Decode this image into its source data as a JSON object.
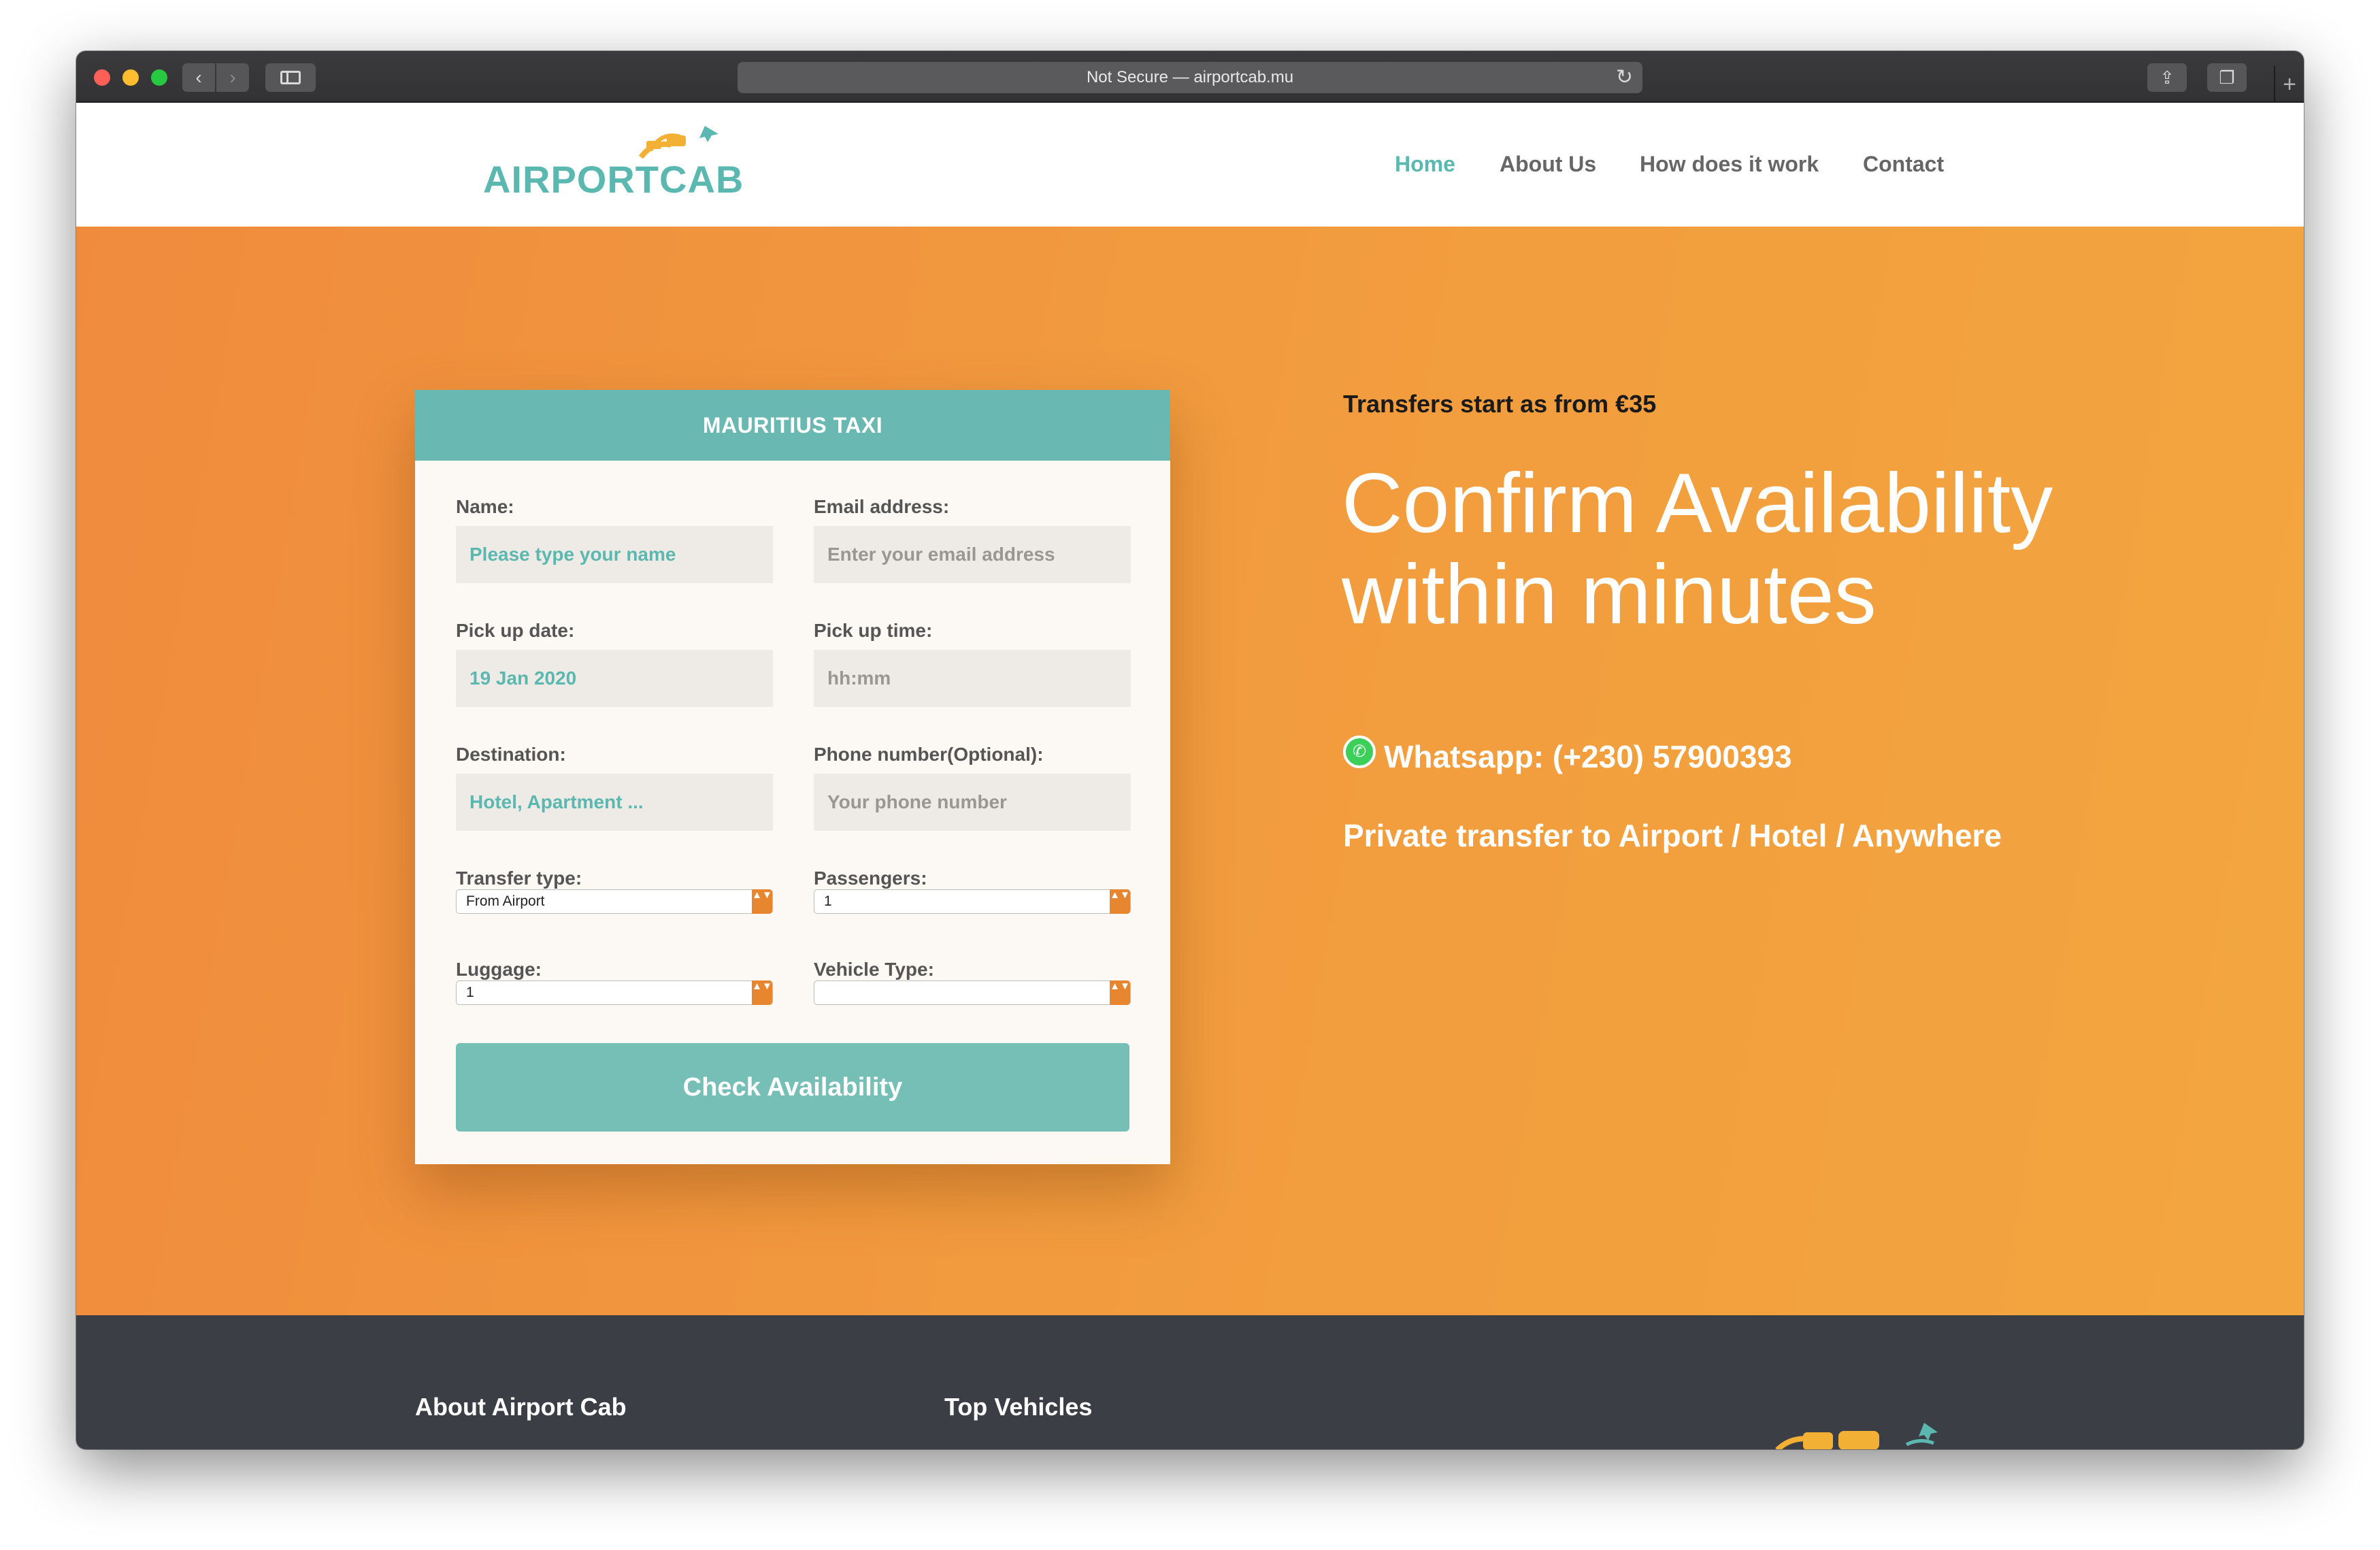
{
  "browser": {
    "url_text": "Not Secure — airportcab.mu",
    "back_glyph": "‹",
    "forward_glyph": "›",
    "reload_glyph": "↻",
    "share_glyph": "⇪",
    "tabs_glyph": "❐",
    "new_tab_glyph": "+"
  },
  "header": {
    "logo": {
      "part1": "AIRPORT",
      "part2": "CAB"
    },
    "nav": [
      "Home",
      "About Us",
      "How does it work",
      "Contact"
    ],
    "active_nav": "Home"
  },
  "form": {
    "title": "MAURITIUS TAXI",
    "name_label": "Name:",
    "name_placeholder": "Please type your name",
    "email_label": "Email address:",
    "email_placeholder": "Enter your email address",
    "date_label": "Pick up date:",
    "date_value": "19 Jan 2020",
    "time_label": "Pick up time:",
    "time_placeholder": "hh:mm",
    "destination_label": "Destination:",
    "destination_placeholder": "Hotel, Apartment ...",
    "phone_label": "Phone number(Optional):",
    "phone_placeholder": "Your phone number",
    "transfer_label": "Transfer type:",
    "transfer_value": "From Airport",
    "passengers_label": "Passengers:",
    "passengers_value": "1",
    "luggage_label": "Luggage:",
    "luggage_value": "1",
    "vehicle_label": "Vehicle Type:",
    "vehicle_value": "",
    "select_arrows": "▲▼",
    "submit_label": "Check Availability"
  },
  "hero": {
    "promo": "Transfers start as from €35",
    "headline": "Confirm Availability within minutes",
    "whatsapp_icon": "phone-icon",
    "whatsapp_glyph": "✆",
    "whatsapp": "Whatsapp: (+230) 57900393",
    "tagline": "Private transfer to Airport / Hotel / Anywhere"
  },
  "footer": {
    "about_heading": "About Airport Cab",
    "vehicles_heading": "Top Vehicles"
  },
  "colors": {
    "accent_teal": "#5bb8b0",
    "hero_orange": "#f19a3e",
    "footer_dark": "#3b3e44"
  }
}
